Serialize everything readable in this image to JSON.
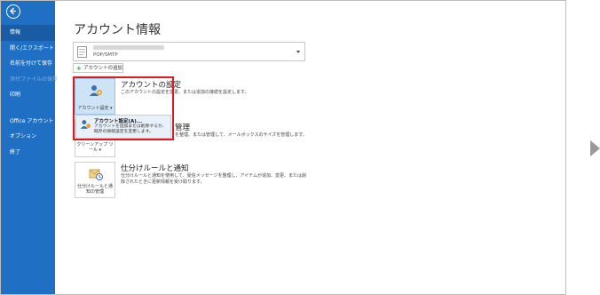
{
  "page_title": "アカウント情報",
  "nav": {
    "items": [
      {
        "label": "情報",
        "state": "active"
      },
      {
        "label": "開く/エクスポート",
        "state": "normal"
      },
      {
        "label": "名前を付けて保存",
        "state": "normal"
      },
      {
        "label": "添付ファイルの保存",
        "state": "disabled"
      },
      {
        "label": "印刷",
        "state": "normal"
      },
      {
        "label": "Office アカウント",
        "state": "normal"
      },
      {
        "label": "オプション",
        "state": "normal"
      },
      {
        "label": "終了",
        "state": "normal"
      }
    ]
  },
  "account": {
    "type": "POP/SMTP",
    "add_label": "アカウントの追加"
  },
  "sections": {
    "settings": {
      "tile_label": "アカウント設定 ▾",
      "title": "アカウントの設定",
      "desc": "このアカウントの設定を変更、または追加の接続を設定します。"
    },
    "cleanup": {
      "tile_label": "クリーンアップ ツール ▾",
      "title": "管理",
      "desc": "を整理、または管理して、メールボックスのサイズを管理します。"
    },
    "rules": {
      "tile_label": "仕分けルールと通知の管理",
      "title": "仕分けルールと通知",
      "desc": "仕分けルールと通知を使用して、受信メッセージを整理し、アイテムが追加、変更、または削除されたときに更新情報を受け取ります。"
    }
  },
  "dropdown": {
    "item_title": "アカウント設定(A)...",
    "item_desc": "アカウントを追加または削除するか、既存の接続設定を変更します。"
  },
  "colors": {
    "sidebar": "#1f6fc4",
    "highlight": "#e0191f"
  }
}
